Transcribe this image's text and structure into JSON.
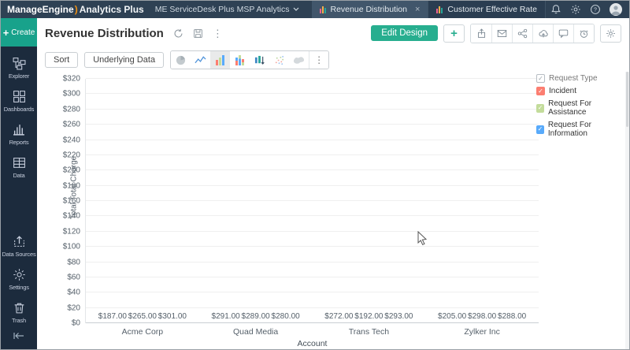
{
  "topbar": {
    "logo": {
      "part1": "ManageEngine",
      "paren": ")",
      "part2": "Analytics Plus"
    },
    "workspace": "ME ServiceDesk Plus MSP Analytics",
    "workspace_chevron": "⌄",
    "tabs": [
      {
        "label": "Revenue Distribution",
        "active": true,
        "close_glyph": "×"
      },
      {
        "label": "Customer Effective Rate",
        "active": false
      }
    ],
    "right_icons": [
      "notifications-bell-icon",
      "settings-gear-icon",
      "help-icon",
      "user-avatar"
    ]
  },
  "sidebar": {
    "create_label": "Create",
    "create_plus": "+",
    "items": [
      {
        "label": "Explorer",
        "icon": "explorer-icon"
      },
      {
        "label": "Dashboards",
        "icon": "dashboards-icon"
      },
      {
        "label": "Reports",
        "icon": "reports-icon"
      },
      {
        "label": "Data",
        "icon": "data-icon"
      }
    ],
    "bottom_items": [
      {
        "label": "Data Sources",
        "icon": "data-sources-icon"
      },
      {
        "label": "Settings",
        "icon": "settings-icon"
      },
      {
        "label": "Trash",
        "icon": "trash-icon"
      }
    ]
  },
  "header": {
    "title": "Revenue Distribution",
    "title_icons": [
      "refresh-icon",
      "save-icon",
      "kebab-menu-icon"
    ],
    "kebab_glyph": "⋮",
    "edit_design_label": "Edit Design",
    "plus_label": "+",
    "action_icons": [
      "export-icon",
      "email-icon",
      "share-icon",
      "publish-cloud-icon",
      "comment-icon",
      "schedule-alarm-icon",
      "report-settings-gear-icon"
    ]
  },
  "toolbar": {
    "sort_label": "Sort",
    "underlying_data_label": "Underlying Data",
    "chart_types": [
      "pie-chart-icon",
      "line-chart-icon",
      "bar-chart-icon",
      "stacked-bar-icon",
      "bar-updown-icon",
      "scatter-chart-icon",
      "map-chart-icon"
    ],
    "active_chart_type": "bar-chart-icon",
    "more_glyph": "⋮"
  },
  "legend": {
    "header": "Request Type",
    "check_glyph": "✓"
  },
  "colors": {
    "accent_teal": "#27ae8f",
    "topbar": "#2e4154",
    "sidebar": "#1c2b3d",
    "bar_red": "#fc7e71",
    "bar_green": "#c3dc9b",
    "bar_blue": "#58aafb"
  },
  "chart_data": {
    "type": "bar",
    "title": "Revenue Distribution",
    "xlabel": "Account",
    "ylabel": "Total Total Charge",
    "ylim": [
      0,
      320
    ],
    "ytick_step": 20,
    "ytick_prefix": "$",
    "grid": true,
    "legend_position": "right",
    "categories": [
      "Acme Corp",
      "Quad Media",
      "Trans Tech",
      "Zylker Inc"
    ],
    "series": [
      {
        "name": "Incident",
        "color": "#fc7e71",
        "values": [
          187,
          291,
          272,
          205
        ]
      },
      {
        "name": "Request For Assistance",
        "color": "#c3dc9b",
        "values": [
          265,
          289,
          192,
          298
        ]
      },
      {
        "name": "Request For Information",
        "color": "#58aafb",
        "values": [
          301,
          280,
          293,
          288
        ]
      }
    ],
    "data_labels": [
      "$187.00",
      "$265.00",
      "$301.00",
      "$291.00",
      "$289.00",
      "$280.00",
      "$272.00",
      "$192.00",
      "$293.00",
      "$205.00",
      "$298.00",
      "$288.00"
    ]
  }
}
